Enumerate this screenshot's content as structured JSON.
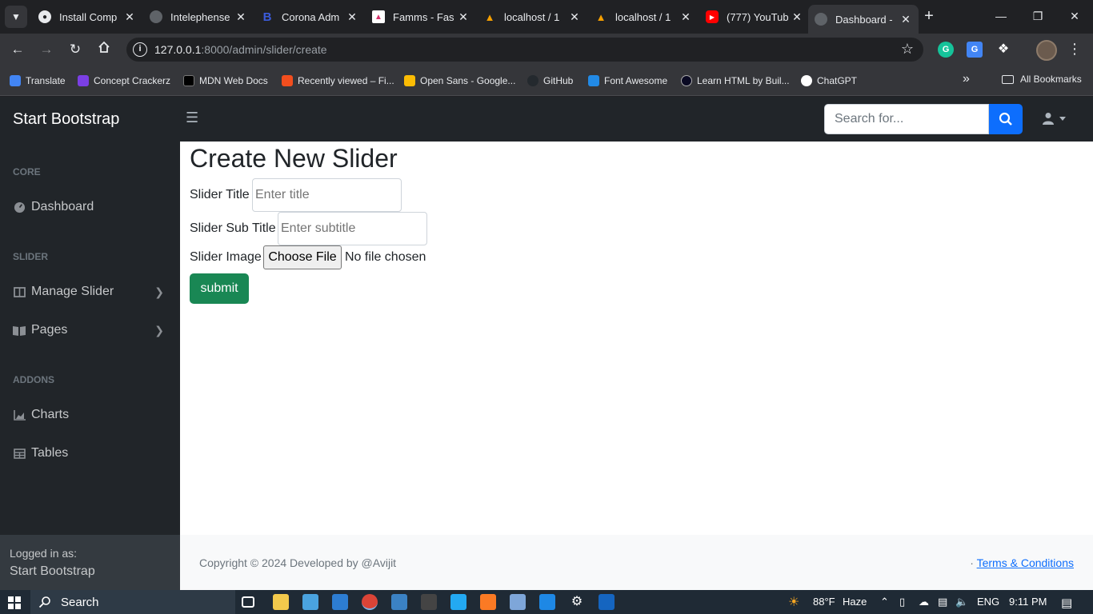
{
  "browser": {
    "tabs": [
      {
        "label": "Install Comp",
        "active": false
      },
      {
        "label": "Intelephense",
        "active": false
      },
      {
        "label": "Corona Adm",
        "active": false
      },
      {
        "label": "Famms - Fas",
        "active": false
      },
      {
        "label": "localhost / 1",
        "active": false
      },
      {
        "label": "localhost / 1",
        "active": false
      },
      {
        "label": "(777) YouTub",
        "active": false
      },
      {
        "label": "Dashboard -",
        "active": true
      }
    ],
    "url_host": "127.0.0.1",
    "url_path": ":8000/admin/slider/create",
    "bookmarks": [
      {
        "label": "Translate",
        "color": "#4285f4"
      },
      {
        "label": "Concept Crackerz",
        "color": "#7b3fe4"
      },
      {
        "label": "MDN Web Docs",
        "color": "#000000"
      },
      {
        "label": "Recently viewed – Fi...",
        "color": "#f24e1e"
      },
      {
        "label": "Open Sans - Google...",
        "color": "#fbbc04"
      },
      {
        "label": "GitHub",
        "color": "#24292e"
      },
      {
        "label": "Font Awesome",
        "color": "#228ae6"
      },
      {
        "label": "Learn HTML by Buil...",
        "color": "#0a0a23"
      },
      {
        "label": "ChatGPT",
        "color": "#ffffff"
      }
    ],
    "all_bookmarks": "All Bookmarks"
  },
  "topnav": {
    "brand": "Start Bootstrap",
    "search_placeholder": "Search for..."
  },
  "sidebar": {
    "headings": {
      "core": "CORE",
      "slider": "SLIDER",
      "addons": "ADDONS"
    },
    "items": {
      "dashboard": "Dashboard",
      "manage_slider": "Manage Slider",
      "pages": "Pages",
      "charts": "Charts",
      "tables": "Tables"
    },
    "footer": {
      "small": "Logged in as:",
      "name": "Start Bootstrap"
    }
  },
  "main": {
    "title": "Create New Slider",
    "fields": {
      "title_label": "Slider Title",
      "title_placeholder": "Enter title",
      "subtitle_label": "Slider Sub Title",
      "subtitle_placeholder": "Enter subtitle",
      "image_label": "Slider Image",
      "choose_file": "Choose File",
      "no_file": "No file chosen"
    },
    "submit": "submit"
  },
  "footer": {
    "copyright": "Copyright © 2024 Developed by @Avijit",
    "separator": "·",
    "terms": "Terms & Conditions"
  },
  "taskbar": {
    "search": "Search",
    "weather": "88°F",
    "weather_desc": "Haze",
    "lang": "ENG",
    "time": "9:11 PM"
  }
}
